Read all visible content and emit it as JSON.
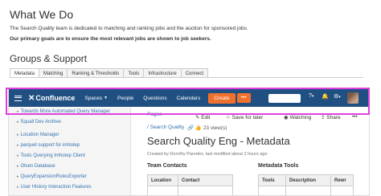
{
  "header": {
    "title": "What We Do",
    "intro": "The Search Quality team is dedicated to matching and ranking jobs and the auction for sponsored jobs.",
    "goals": "Our primary goals are to ensure the most relevant jobs are shown to job seekers."
  },
  "section": {
    "title": "Groups & Support",
    "tabs": [
      "Metadata",
      "Matching",
      "Ranking & Thresholds",
      "Tools",
      "Infrastructure",
      "Connect"
    ]
  },
  "confluence": {
    "logo": "Confluence",
    "nav": {
      "spaces": "Spaces",
      "people": "People",
      "questions": "Questions",
      "calendars": "Calendars",
      "create": "Create",
      "more": "•••"
    },
    "sidebar": [
      "Towards More Automated Query Manager",
      "Squall Dev Archive",
      "Location Manager",
      "parquet support for imhotep",
      "Tools Querying Imhotep Client",
      "Olsen Database",
      "QueryExpansionRulesExporter",
      "User History Interaction Features"
    ],
    "breadcrumb": {
      "pages": "Pages",
      "parent": "/ Search Quality"
    },
    "toolbar": {
      "edit": "Edit",
      "save_later": "Save for later",
      "watching": "Watching",
      "share": "Share"
    },
    "views": "23 view(s)",
    "page": {
      "title": "Search Quality Eng - Metadata",
      "meta": "Created by Dorothy Paredes, last modified about 2 hours ago",
      "contacts_heading": "Team Contacts",
      "contacts_cols": [
        "Location",
        "Contact"
      ],
      "tools_heading": "Metadata Tools",
      "tools_cols": [
        "Tools",
        "Description",
        "Rewr"
      ]
    },
    "colors": {
      "navbar": "#205081",
      "create": "#f0712c",
      "highlight": "#e040e0"
    }
  }
}
